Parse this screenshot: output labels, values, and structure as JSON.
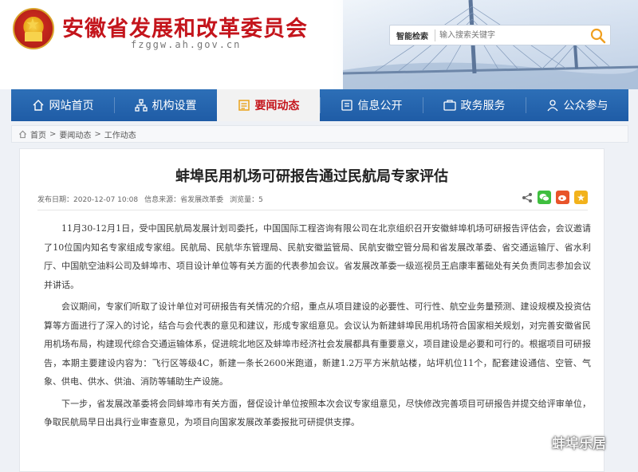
{
  "header": {
    "site_title": "安徽省发展和改革委员会",
    "domain": "fzggw.ah.gov.cn",
    "search_label": "智能检索",
    "search_placeholder": "输入搜索关键字"
  },
  "nav": {
    "items": [
      {
        "label": "网站首页",
        "icon": "home-icon"
      },
      {
        "label": "机构设置",
        "icon": "org-icon"
      },
      {
        "label": "要闻动态",
        "icon": "news-icon",
        "active": true
      },
      {
        "label": "信息公开",
        "icon": "info-icon"
      },
      {
        "label": "政务服务",
        "icon": "service-icon"
      },
      {
        "label": "公众参与",
        "icon": "people-icon"
      }
    ]
  },
  "breadcrumb": {
    "items": [
      "首页",
      "要闻动态",
      "工作动态"
    ],
    "separator": ">"
  },
  "article": {
    "title": "蚌埠民用机场可研报告通过民航局专家评估",
    "publish_time": "发布日期：2020-12-07 10:08",
    "source": "信息来源：省发展改革委",
    "views": "浏览量：5",
    "paragraphs": [
      "11月30-12月1日，受中国民航局发展计划司委托，中国国际工程咨询有限公司在北京组织召开安徽蚌埠机场可研报告评估会，会议邀请了10位国内知名专家组成专家组。民航局、民航华东管理局、民航安徽监管局、民航安徽空管分局和省发展改革委、省交通运输厅、省水利厅、中国航空油料公司及蚌埠市、项目设计单位等有关方面的代表参加会议。省发展改革委一级巡视员王启康率蓄础处有关负责同志参加会议并讲话。",
      "会议期间，专家们听取了设计单位对可研报告有关情况的介绍，重点从项目建设的必要性、可行性、航空业务量预测、建设规模及投资估算等方面进行了深入的讨论，结合与会代表的意见和建议，形成专家组意见。会议认为新建蚌埠民用机场符合国家相关规划，对完善安徽省民用机场布局，构建现代综合交通运输体系，促进皖北地区及蚌埠市经济社会发展都具有重要意义，项目建设是必要和可行的。根据项目可研报告，本期主要建设内容为：飞行区等级4C，新建一条长2600米跑道，新建1.2万平方米航站楼，站坪机位11个，配套建设通信、空管、气象、供电、供水、供油、消防等辅助生产设施。",
      "下一步，省发展改革委将会同蚌埠市有关方面，督促设计单位按照本次会议专家组意见，尽快修改完善项目可研报告并提交给评审单位，争取民航局早日出具行业审查意见，为项目向国家发展改革委报批可研提供支撑。"
    ]
  },
  "share": [
    "wechat-icon",
    "weibo-icon",
    "qzone-icon"
  ],
  "watermark": "蚌埠乐居",
  "colors": {
    "brand_red": "#c4151c",
    "nav_blue": "#1f5ca6"
  }
}
